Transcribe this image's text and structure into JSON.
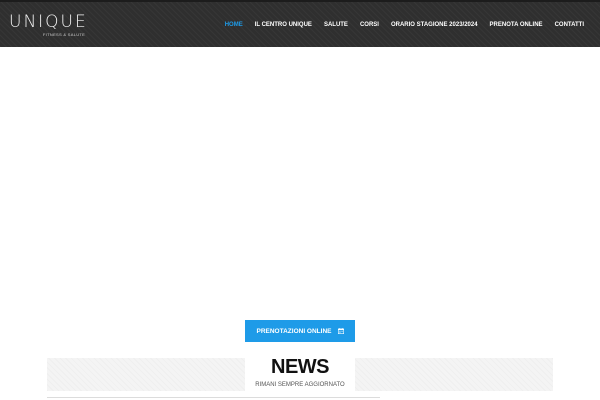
{
  "header": {
    "logo": {
      "word": "UNIQUE",
      "tagline": "FITNESS & SALUTE"
    },
    "nav": [
      {
        "label": "HOME",
        "active": true
      },
      {
        "label": "IL CENTRO UNIQUE",
        "active": false
      },
      {
        "label": "SALUTE",
        "active": false
      },
      {
        "label": "CORSI",
        "active": false
      },
      {
        "label": "ORARIO STAGIONE 2023/2024",
        "active": false
      },
      {
        "label": "PRENOTA ONLINE",
        "active": false
      },
      {
        "label": "CONTATTI",
        "active": false
      }
    ]
  },
  "cta": {
    "label": "PRENOTAZIONI ONLINE",
    "icon": "calendar-icon"
  },
  "news": {
    "title": "NEWS",
    "subtitle": "RIMANI SEMPRE AGGIORNATO"
  },
  "colors": {
    "header_bg": "#2f2f2f",
    "accent": "#1e9be8",
    "nav_text": "#ffffff"
  }
}
